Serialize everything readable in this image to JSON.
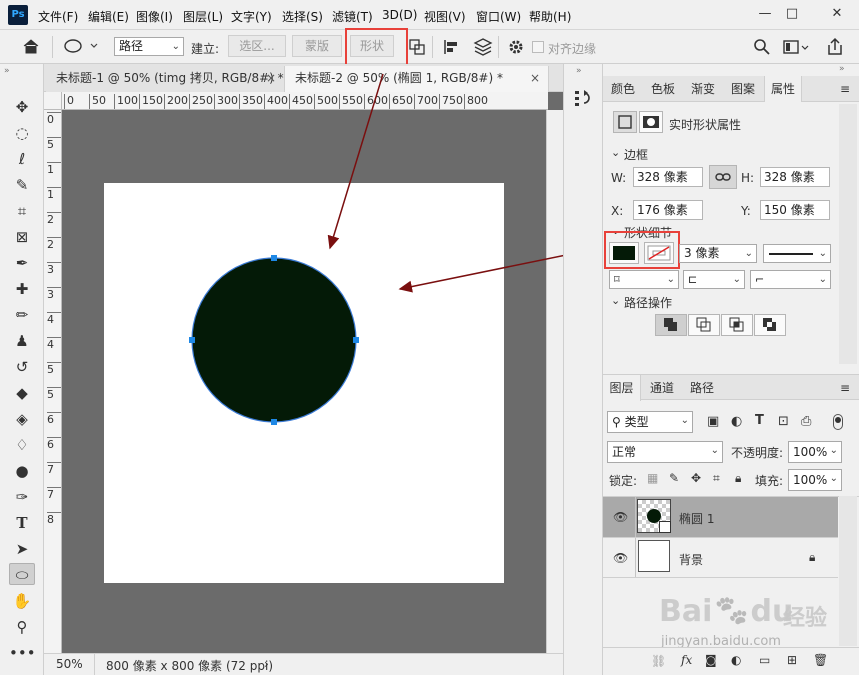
{
  "app": {
    "logo": "Ps"
  },
  "menu": [
    "文件(F)",
    "编辑(E)",
    "图像(I)",
    "图层(L)",
    "文字(Y)",
    "选择(S)",
    "滤镜(T)",
    "3D(D)",
    "视图(V)",
    "窗口(W)",
    "帮助(H)"
  ],
  "window_controls": [
    "—",
    "□",
    "✕"
  ],
  "options": {
    "mode": "路径",
    "make_label": "建立:",
    "selection_btn": "选区...",
    "mask_btn": "蒙版",
    "shape_btn": "形状",
    "align_edges": "对齐边缘"
  },
  "tabs": [
    {
      "label": "未标题-1 @ 50% (timg 拷贝, RGB/8#) *",
      "close": "×"
    },
    {
      "label": "未标题-2 @ 50% (椭圆 1, RGB/8#) *",
      "close": "×"
    }
  ],
  "ruler_h": [
    "0",
    "50",
    "100",
    "150",
    "200",
    "250",
    "300",
    "350",
    "400",
    "450",
    "500",
    "550",
    "600",
    "650",
    "700",
    "750",
    "800"
  ],
  "ruler_v": [
    "0",
    "5",
    "1",
    "1",
    "2",
    "2",
    "3",
    "3",
    "4",
    "4",
    "5",
    "5",
    "6",
    "6",
    "7",
    "7",
    "8"
  ],
  "status": {
    "zoom": "50%",
    "doc_info": "800 像素 x 800 像素 (72 ppi)",
    "arrow": "›"
  },
  "properties_panel": {
    "tabs": [
      "颜色",
      "色板",
      "渐变",
      "图案",
      "属性"
    ],
    "title": "实时形状属性",
    "section_bounds": "边框",
    "w_label": "W:",
    "w_value": "328 像素",
    "h_label": "H:",
    "h_value": "328 像素",
    "x_label": "X:",
    "x_value": "176 像素",
    "y_label": "Y:",
    "y_value": "150 像素",
    "section_shape": "形状细节",
    "stroke_width": "3 像素",
    "section_path": "路径操作"
  },
  "layers_panel": {
    "tabs": [
      "图层",
      "通道",
      "路径"
    ],
    "kind": "类型",
    "blend": "正常",
    "opacity_label": "不透明度:",
    "opacity": "100%",
    "lock_label": "锁定:",
    "fill_label": "填充:",
    "fill": "100%",
    "layers": [
      {
        "name": "椭圆 1",
        "selected": true
      },
      {
        "name": "背景",
        "selected": false
      }
    ]
  },
  "watermark": {
    "brand": "Bai",
    "brand2": "du",
    "cn": "经验",
    "url": "jingyan.baidu.com"
  },
  "colors": {
    "fill": "#041a07",
    "accent": "#e8413a",
    "arrow": "#7a0f0f",
    "handle": "#1e88e5"
  }
}
